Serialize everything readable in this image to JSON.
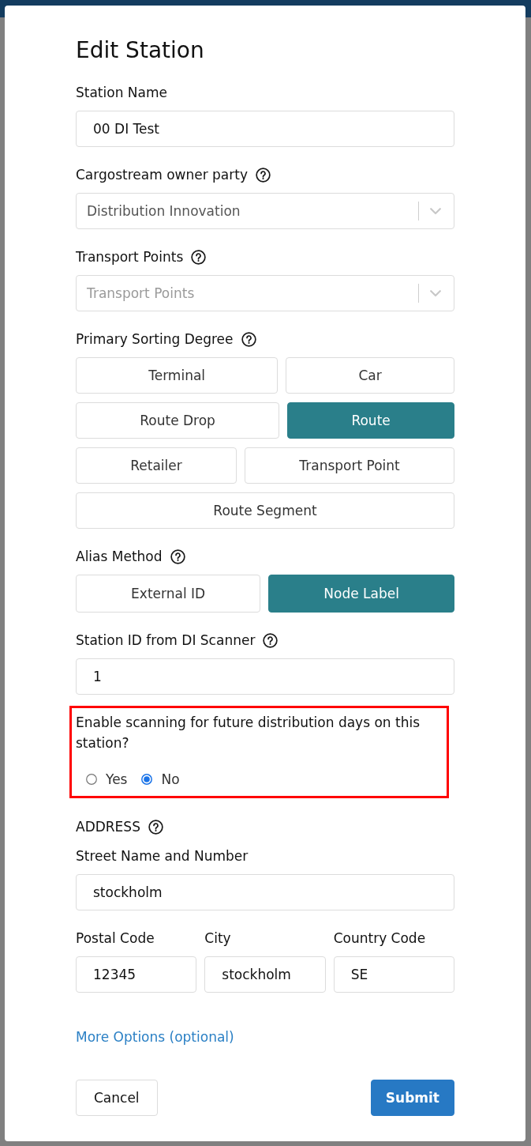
{
  "title": "Edit Station",
  "fields": [
    {
      "kind": "text",
      "label": "Station Name",
      "value": "00 DI Test"
    },
    {
      "kind": "select",
      "label": "Cargostream owner party",
      "help": true,
      "value": "Distribution Innovation"
    },
    {
      "kind": "select",
      "label": "Transport Points",
      "help": true,
      "placeholder": "Transport Points"
    },
    {
      "kind": "choice",
      "label": "Primary Sorting Degree",
      "help": true,
      "options": [
        {
          "label": "Terminal",
          "selected": false
        },
        {
          "label": "Car",
          "selected": false
        },
        {
          "label": "Route Drop",
          "selected": false
        },
        {
          "label": "Route",
          "selected": true
        },
        {
          "label": "Retailer",
          "selected": false
        },
        {
          "label": "Transport Point",
          "selected": false
        },
        {
          "label": "Route Segment",
          "selected": false
        }
      ]
    },
    {
      "kind": "choice",
      "label": "Alias Method",
      "help": true,
      "options": [
        {
          "label": "External ID",
          "selected": false
        },
        {
          "label": "Node Label",
          "selected": true
        }
      ]
    },
    {
      "kind": "text",
      "label": "Station ID from DI Scanner",
      "help": true,
      "value": "1"
    },
    {
      "kind": "radio",
      "highlighted": true,
      "question": "Enable scanning for future distribution days on this station?",
      "options": [
        {
          "label": "Yes",
          "selected": false
        },
        {
          "label": "No",
          "selected": true
        }
      ]
    }
  ],
  "address": {
    "heading": "ADDRESS",
    "help": true,
    "street": {
      "label": "Street Name and Number",
      "value": "stockholm"
    },
    "columns": [
      {
        "label": "Postal Code",
        "value": "12345"
      },
      {
        "label": "City",
        "value": "stockholm"
      },
      {
        "label": "Country Code",
        "value": "SE"
      }
    ]
  },
  "more_options_link": "More Options (optional)",
  "buttons": [
    {
      "kind": "secondary",
      "label": "Cancel"
    },
    {
      "kind": "primary",
      "label": "Submit"
    }
  ]
}
